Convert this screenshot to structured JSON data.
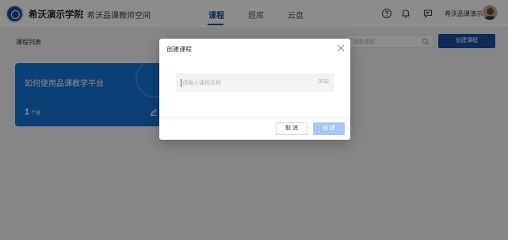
{
  "header": {
    "school_name": "希沃演示学院",
    "space_name": "希沃品课教师空间",
    "nav": [
      {
        "label": "课程",
        "active": true
      },
      {
        "label": "题库",
        "active": false
      },
      {
        "label": "云盘",
        "active": false
      }
    ],
    "user_name": "希沃品课演示",
    "accent_color": "#1f4e96"
  },
  "page": {
    "list_title": "课程列表",
    "search_placeholder": "搜索课程",
    "create_button_label": "创建课程"
  },
  "course_card": {
    "title": "如何使用品课教学平台",
    "count": "1",
    "count_unit": "个班",
    "color": "#1673d6"
  },
  "modal": {
    "title": "创建课程",
    "name_placeholder": "请输入课程名称",
    "char_count": "0/32",
    "cancel_label": "取 消",
    "confirm_label": "创 建"
  }
}
